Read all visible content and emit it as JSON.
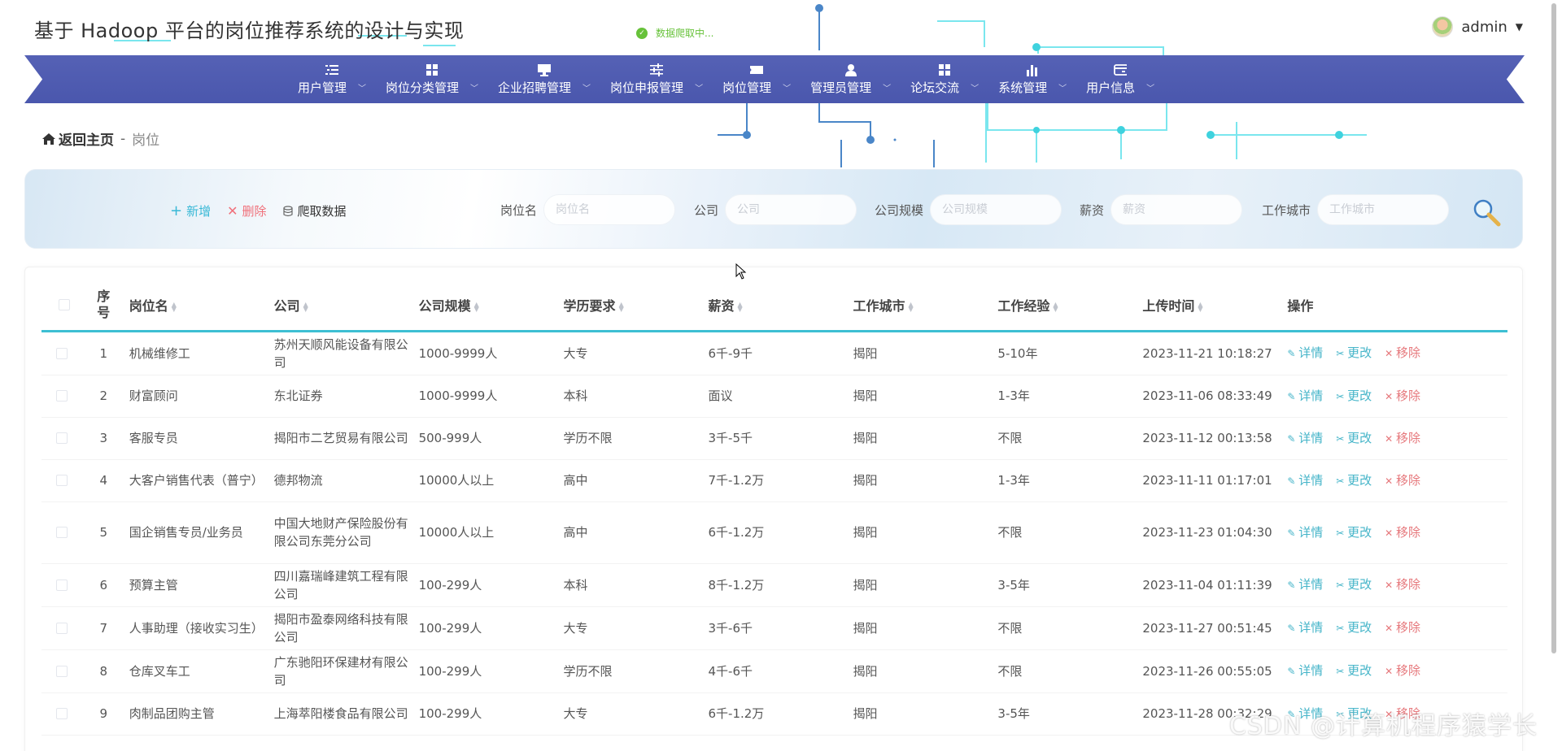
{
  "app": {
    "title": "基于 Hadoop 平台的岗位推荐系统的设计与实现"
  },
  "toast": {
    "text": "数据爬取中..."
  },
  "user": {
    "name": "admin"
  },
  "nav": {
    "items": [
      {
        "label": "用户管理",
        "icon": "list-icon"
      },
      {
        "label": "岗位分类管理",
        "icon": "grid-icon"
      },
      {
        "label": "企业招聘管理",
        "icon": "monitor-icon"
      },
      {
        "label": "岗位申报管理",
        "icon": "sliders-icon"
      },
      {
        "label": "岗位管理",
        "icon": "ticket-icon"
      },
      {
        "label": "管理员管理",
        "icon": "user-icon"
      },
      {
        "label": "论坛交流",
        "icon": "grid-icon"
      },
      {
        "label": "系统管理",
        "icon": "bar-chart-icon"
      },
      {
        "label": "用户信息",
        "icon": "card-icon"
      }
    ]
  },
  "breadcrumb": {
    "home": "返回主页",
    "sep": "-",
    "current": "岗位"
  },
  "actions": {
    "add": "新增",
    "delete": "删除",
    "crawl": "爬取数据"
  },
  "filters": [
    {
      "label": "岗位名",
      "placeholder": "岗位名"
    },
    {
      "label": "公司",
      "placeholder": "公司"
    },
    {
      "label": "公司规模",
      "placeholder": "公司规模"
    },
    {
      "label": "薪资",
      "placeholder": "薪资"
    },
    {
      "label": "工作城市",
      "placeholder": "工作城市"
    }
  ],
  "table": {
    "headers": {
      "seq": "序号",
      "name": "岗位名",
      "company": "公司",
      "scale": "公司规模",
      "education": "学历要求",
      "salary": "薪资",
      "city": "工作城市",
      "experience": "工作经验",
      "upload_time": "上传时间",
      "ops": "操作"
    },
    "op_labels": {
      "detail": "详情",
      "edit": "更改",
      "remove": "移除"
    },
    "rows": [
      {
        "seq": "1",
        "name": "机械维修工",
        "company": "苏州天顺风能设备有限公司",
        "scale": "1000-9999人",
        "education": "大专",
        "salary": "6千-9千",
        "city": "揭阳",
        "experience": "5-10年",
        "time": "2023-11-21 10:18:27"
      },
      {
        "seq": "2",
        "name": "财富顾问",
        "company": "东北证券",
        "scale": "1000-9999人",
        "education": "本科",
        "salary": "面议",
        "city": "揭阳",
        "experience": "1-3年",
        "time": "2023-11-06 08:33:49"
      },
      {
        "seq": "3",
        "name": "客服专员",
        "company": "揭阳市二艺贸易有限公司",
        "scale": "500-999人",
        "education": "学历不限",
        "salary": "3千-5千",
        "city": "揭阳",
        "experience": "不限",
        "time": "2023-11-12 00:13:58"
      },
      {
        "seq": "4",
        "name": "大客户销售代表（普宁）",
        "company": "德邦物流",
        "scale": "10000人以上",
        "education": "高中",
        "salary": "7千-1.2万",
        "city": "揭阳",
        "experience": "1-3年",
        "time": "2023-11-11 01:17:01"
      },
      {
        "seq": "5",
        "name": "国企销售专员/业务员",
        "company": "中国大地财产保险股份有限公司东莞分公司",
        "scale": "10000人以上",
        "education": "高中",
        "salary": "6千-1.2万",
        "city": "揭阳",
        "experience": "不限",
        "time": "2023-11-23 01:04:30"
      },
      {
        "seq": "6",
        "name": "预算主管",
        "company": "四川嘉瑞峰建筑工程有限公司",
        "scale": "100-299人",
        "education": "本科",
        "salary": "8千-1.2万",
        "city": "揭阳",
        "experience": "3-5年",
        "time": "2023-11-04 01:11:39"
      },
      {
        "seq": "7",
        "name": "人事助理（接收实习生）",
        "company": "揭阳市盈泰网络科技有限公司",
        "scale": "100-299人",
        "education": "大专",
        "salary": "3千-6千",
        "city": "揭阳",
        "experience": "不限",
        "time": "2023-11-27 00:51:45"
      },
      {
        "seq": "8",
        "name": "仓库叉车工",
        "company": "广东驰阳环保建材有限公司",
        "scale": "100-299人",
        "education": "学历不限",
        "salary": "4千-6千",
        "city": "揭阳",
        "experience": "不限",
        "time": "2023-11-26 00:55:05"
      },
      {
        "seq": "9",
        "name": "肉制品团购主管",
        "company": "上海萃阳楼食品有限公司",
        "scale": "100-299人",
        "education": "大专",
        "salary": "6千-1.2万",
        "city": "揭阳",
        "experience": "3-5年",
        "time": "2023-11-28 00:32:29"
      }
    ]
  },
  "watermark": "CSDN @计算机程序猿学长",
  "colors": {
    "nav_bg": "#4a57ad",
    "accent": "#3dbfd3",
    "danger": "#f0707a",
    "success": "#67c23a"
  }
}
